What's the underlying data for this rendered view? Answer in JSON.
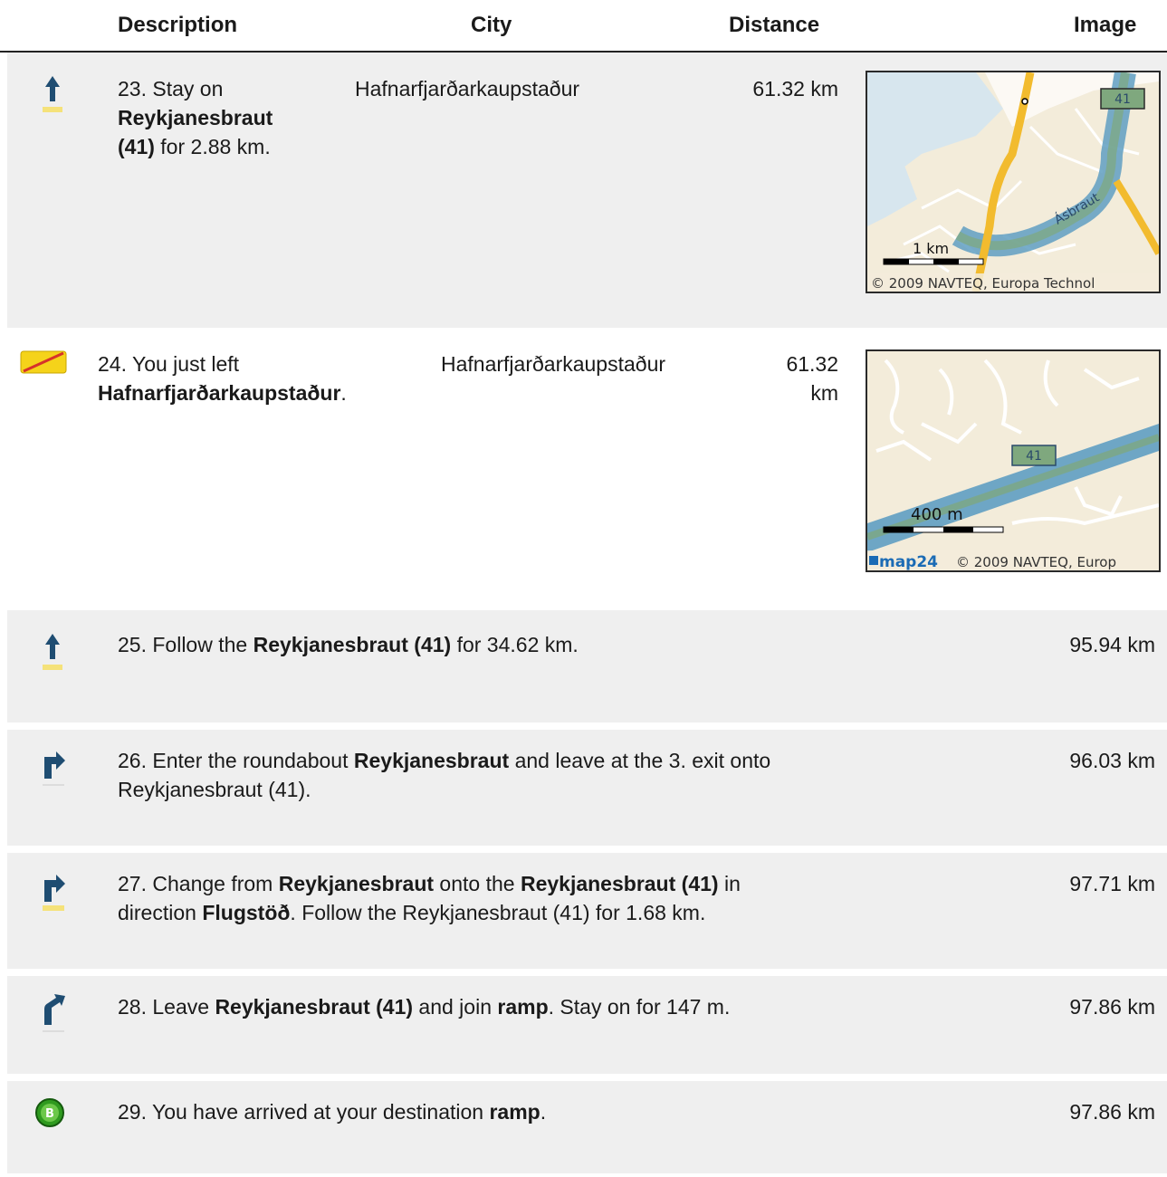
{
  "header": {
    "description": "Description",
    "city": "City",
    "distance": "Distance",
    "image": "Image"
  },
  "steps": [
    {
      "n": "23.",
      "pre": "Stay on ",
      "bold1": "Reykjanesbraut",
      "bold1b": "(41)",
      "post": " for 2.88 km.",
      "city": "Hafnarfjarðarkaupstaður",
      "distance": "61.32 km",
      "map": {
        "route": "41",
        "scale": "1 km",
        "road": "Ásbraut",
        "credit": "© 2009 NAVTEQ, Europa Technol"
      }
    },
    {
      "n": "24.",
      "pre": "You just left ",
      "bold1": "Hafnarfjarðarkaupstaður",
      "post": ".",
      "city": "Hafnarfjarðarkaupstaður",
      "distance_1": "61.32",
      "distance_2": "km",
      "map": {
        "route": "41",
        "scale": "400 m",
        "logo": "map24",
        "credit": "© 2009 NAVTEQ, Europ"
      }
    },
    {
      "n": "25.",
      "pre": "Follow the ",
      "bold1": "Reykjanesbraut (41)",
      "post": " for 34.62 km.",
      "distance": "95.94 km"
    },
    {
      "n": "26.",
      "pre": "Enter the roundabout ",
      "bold1": "Reykjanesbraut",
      "mid": " and leave at the 3. exit onto",
      "line2": "Reykjanesbraut (41).",
      "distance": "96.03 km"
    },
    {
      "n": "27.",
      "pre": "Change from ",
      "bold1": "Reykjanesbraut",
      "mid": " onto the ",
      "bold2": "Reykjanesbraut (41)",
      "post": " in",
      "line2_pre": "direction ",
      "line2_bold": "Flugstöð",
      "line2_post": ". Follow the Reykjanesbraut (41) for 1.68 km.",
      "distance": "97.71 km"
    },
    {
      "n": "28.",
      "pre": "Leave ",
      "bold1": "Reykjanesbraut (41)",
      "mid": " and join ",
      "bold2": "ramp",
      "post": ". Stay on for 147 m.",
      "distance": "97.86 km"
    },
    {
      "n": "29.",
      "pre": "You have arrived at your destination ",
      "bold1": "ramp",
      "post": ".",
      "distance": "97.86 km",
      "marker": "B"
    }
  ],
  "colors": {
    "row_grey": "#efefef",
    "arrow_blue": "#1f4d72",
    "highway_blue": "#5f9fc2",
    "road_yellow": "#f2bb2e",
    "sign_yellow": "#f5e27a"
  },
  "icons": [
    "straight-arrow-icon",
    "town-exit-sign-icon",
    "straight-arrow-icon",
    "right-turn-icon",
    "right-turn-icon",
    "ramp-exit-icon",
    "destination-b-icon"
  ]
}
